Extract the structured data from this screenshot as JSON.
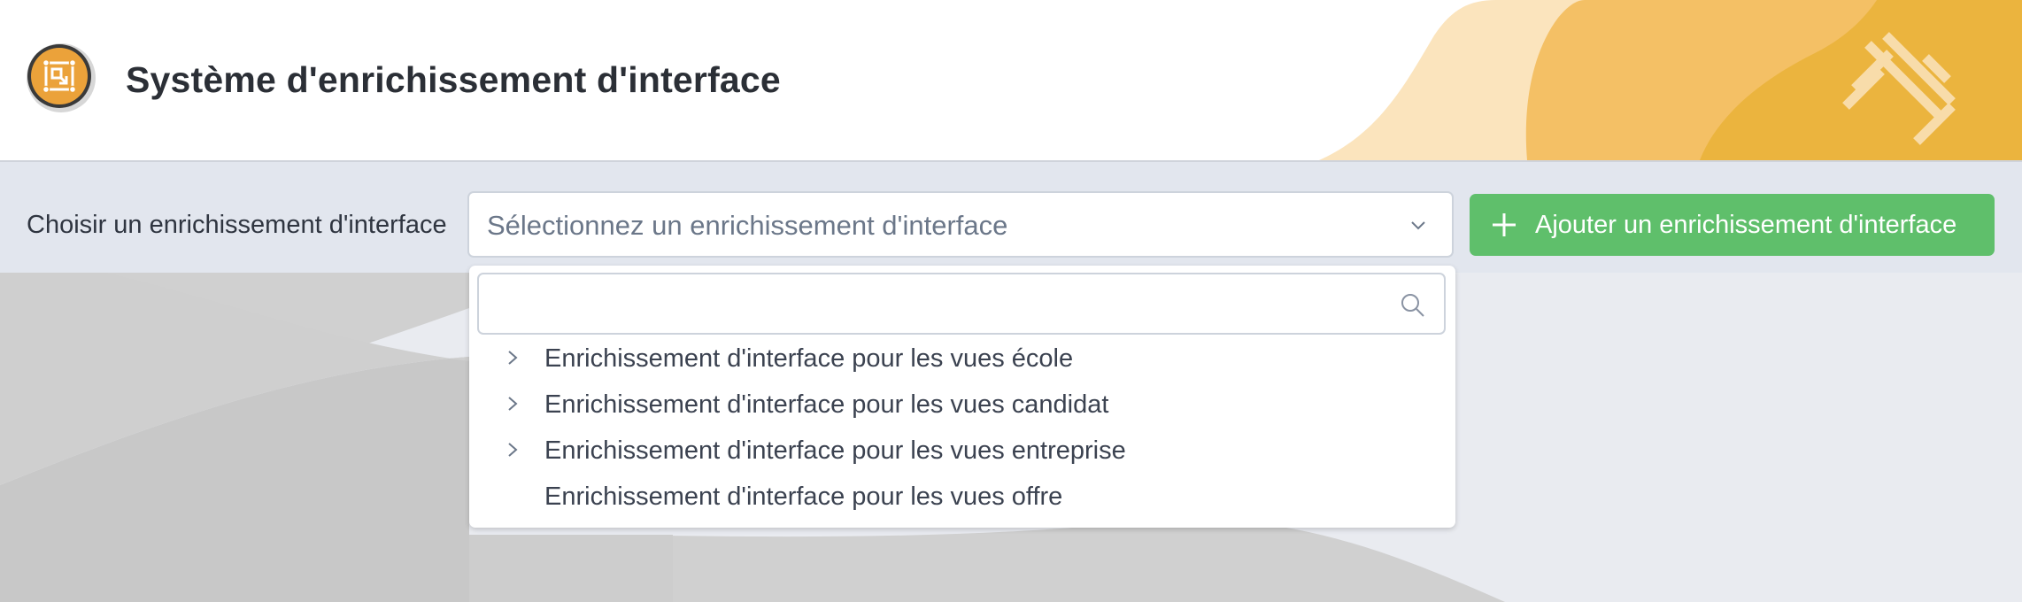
{
  "header": {
    "title": "Système d'enrichissement d'interface",
    "logo_icon": "interface-frame-icon",
    "watermark_icon": "crossed-bars-icon"
  },
  "toolbar": {
    "choose_label": "Choisir un enrichissement d'interface",
    "select_placeholder": "Sélectionnez un enrichissement d'interface",
    "add_button_label": "Ajouter un enrichissement d'interface"
  },
  "dropdown": {
    "search_value": "",
    "options": [
      {
        "label": "Enrichissement d'interface pour les vues école",
        "has_children": true
      },
      {
        "label": "Enrichissement d'interface pour les vues candidat",
        "has_children": true
      },
      {
        "label": "Enrichissement d'interface pour les vues entreprise",
        "has_children": true
      },
      {
        "label": "Enrichissement d'interface pour les vues offre",
        "has_children": false
      }
    ]
  },
  "colors": {
    "accent_orange": "#e8a23a",
    "add_button_green": "#5fbf6b",
    "title_text": "#2b2f36"
  }
}
